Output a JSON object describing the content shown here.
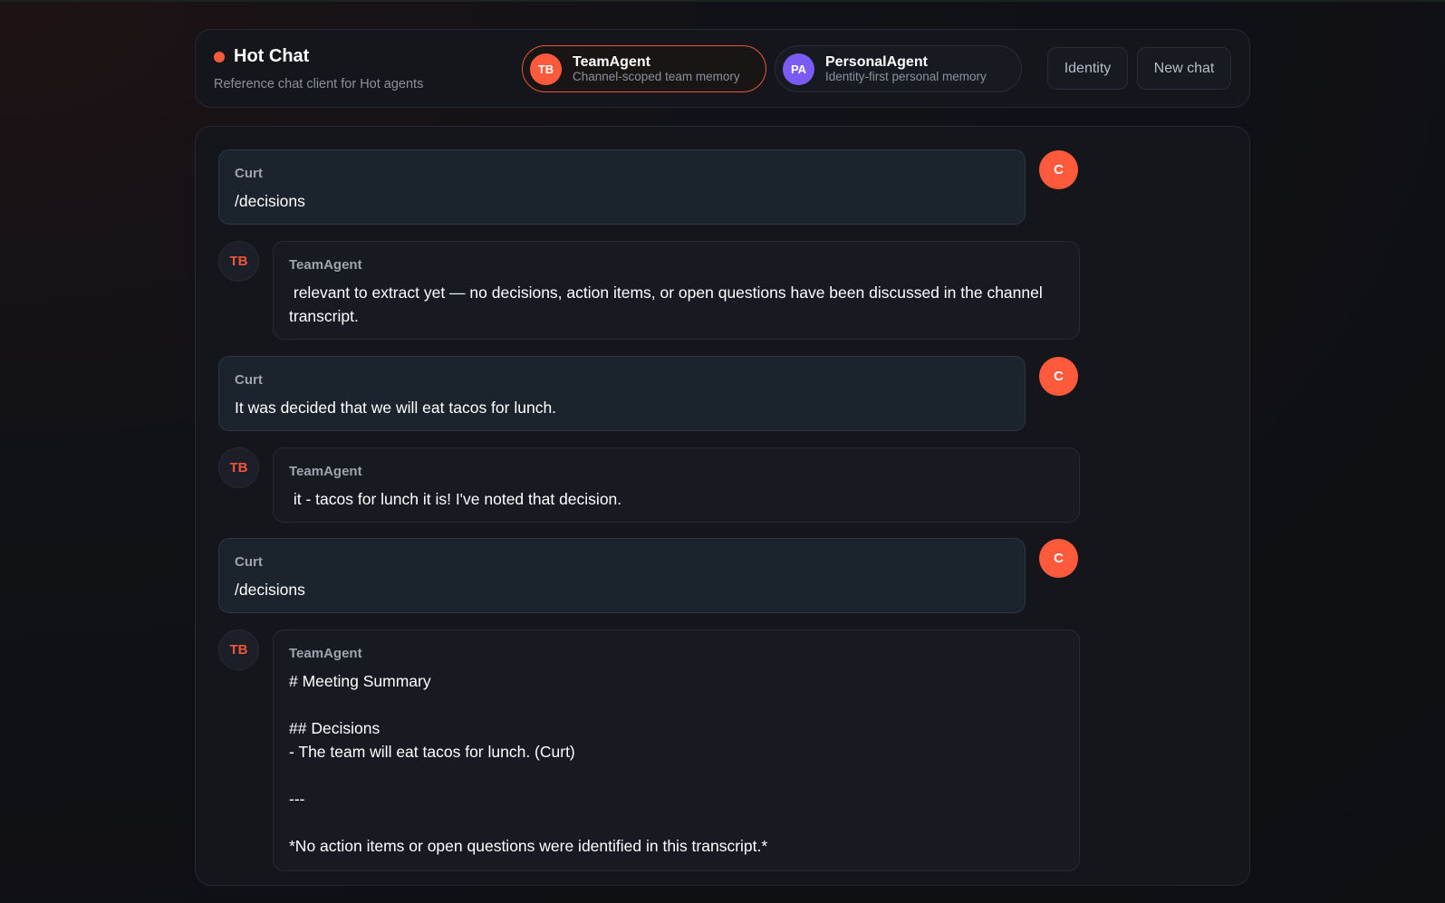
{
  "app": {
    "title": "Hot Chat",
    "subtitle": "Reference chat client for Hot agents",
    "status_color": "#ff5a3c"
  },
  "agents": [
    {
      "initials": "TB",
      "name": "TeamAgent",
      "description": "Channel-scoped team memory",
      "active": true,
      "color": "#ff5a3c"
    },
    {
      "initials": "PA",
      "name": "PersonalAgent",
      "description": "Identity-first personal memory",
      "active": false,
      "color": "#7a5cf5"
    }
  ],
  "header_buttons": {
    "identity": "Identity",
    "new_chat": "New chat"
  },
  "messages": [
    {
      "role": "user",
      "author": "Curt",
      "avatar": "C",
      "text": "/decisions"
    },
    {
      "role": "agent",
      "author": "TeamAgent",
      "avatar": "TB",
      "text": " relevant to extract yet — no decisions, action items, or open questions have been discussed in the channel transcript."
    },
    {
      "role": "user",
      "author": "Curt",
      "avatar": "C",
      "text": "It was decided that we will eat tacos for lunch."
    },
    {
      "role": "agent",
      "author": "TeamAgent",
      "avatar": "TB",
      "text": " it - tacos for lunch it is! I've noted that decision."
    },
    {
      "role": "user",
      "author": "Curt",
      "avatar": "C",
      "text": "/decisions"
    },
    {
      "role": "agent",
      "author": "TeamAgent",
      "avatar": "TB",
      "text": "# Meeting Summary\n\n## Decisions\n- The team will eat tacos for lunch. (Curt)\n\n---\n\n*No action items or open questions were identified in this transcript.*"
    }
  ]
}
